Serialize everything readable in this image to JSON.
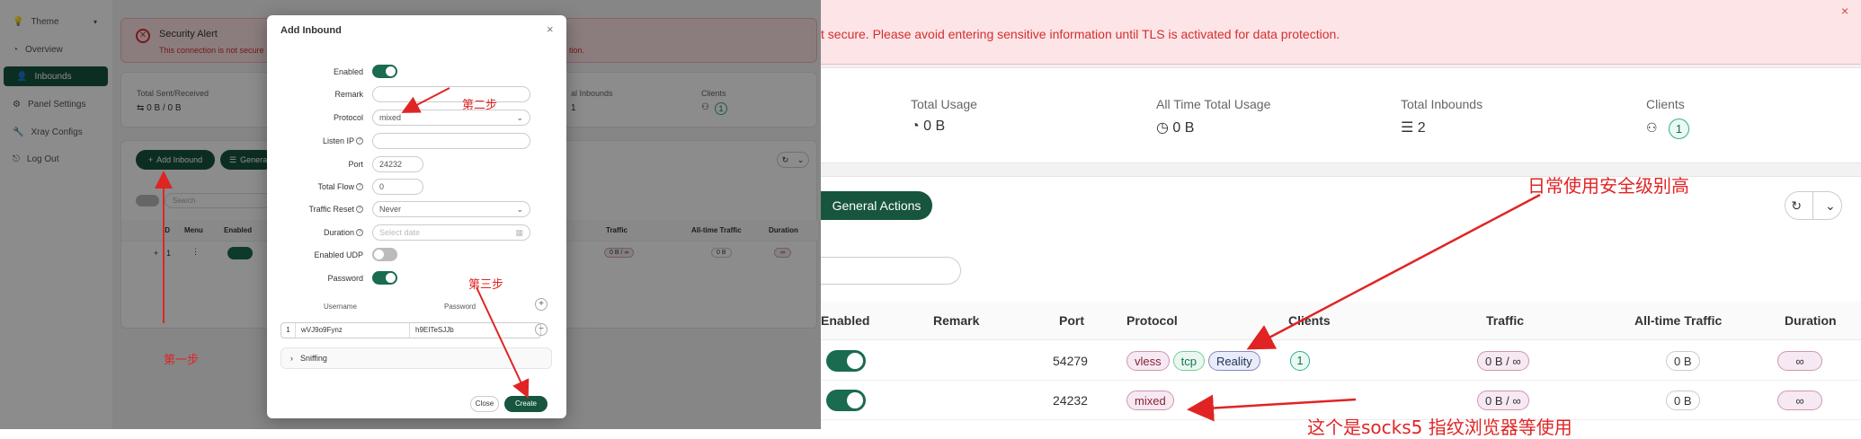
{
  "sidebar": {
    "items": [
      {
        "label": "Theme",
        "icon": "bulb-icon"
      },
      {
        "label": "Overview",
        "icon": "dashboard-icon"
      },
      {
        "label": "Inbounds",
        "icon": "user-icon"
      },
      {
        "label": "Panel Settings",
        "icon": "gear-icon"
      },
      {
        "label": "Xray Configs",
        "icon": "tool-icon"
      },
      {
        "label": "Log Out",
        "icon": "logout-icon"
      }
    ]
  },
  "alert": {
    "title": "Security Alert",
    "left_text": "This connection is not secure",
    "left_text_tail": "tion.",
    "right_text": "t secure. Please avoid entering sensitive information until TLS is activated for data protection."
  },
  "stats_left": {
    "sent_label": "Total Sent/Received",
    "sent_value": "0 B / 0 B",
    "inbounds_label": "al Inbounds",
    "inbounds_value": "1",
    "clients_label": "Clients",
    "clients_value": "1"
  },
  "stats_right": {
    "total_usage_label": "Total Usage",
    "total_usage_value": "0 B",
    "all_time_label": "All Time Total Usage",
    "all_time_value": "0 B",
    "inbounds_label": "Total Inbounds",
    "inbounds_value": "2",
    "clients_label": "Clients",
    "clients_value": "1"
  },
  "actions": {
    "add_inbound": "Add Inbound",
    "general": "Genera",
    "general_actions": "General Actions"
  },
  "left_table": {
    "search_placeholder": "Search",
    "headers": [
      "ID",
      "Menu",
      "Enabled",
      "Traffic",
      "All-time Traffic",
      "Duration"
    ],
    "row": {
      "id": "1",
      "traffic": "0 B / ∞",
      "all_time": "0 B",
      "duration": "∞"
    }
  },
  "modal": {
    "title": "Add Inbound",
    "fields": {
      "enabled": "Enabled",
      "remark": "Remark",
      "protocol": "Protocol",
      "protocol_value": "mixed",
      "listen_ip": "Listen IP",
      "port": "Port",
      "port_value": "24232",
      "total_flow": "Total Flow",
      "total_flow_value": "0",
      "traffic_reset": "Traffic Reset",
      "traffic_reset_value": "Never",
      "duration": "Duration",
      "duration_placeholder": "Select date",
      "enabled_udp": "Enabled UDP",
      "password": "Password"
    },
    "accounts": {
      "username_header": "Username",
      "password_header": "Password",
      "row_index": "1",
      "username": "wVJ9o9Fynz",
      "password": "h9EITeSJJb"
    },
    "sniffing": "Sniffing",
    "close": "Close",
    "create": "Create"
  },
  "right_table": {
    "headers": [
      "Enabled",
      "Remark",
      "Port",
      "Protocol",
      "Clients",
      "Traffic",
      "All-time Traffic",
      "Duration"
    ],
    "rows": [
      {
        "port": "54279",
        "protocols": [
          "vless",
          "tcp",
          "Reality"
        ],
        "clients": "1",
        "traffic": "0 B / ∞",
        "all_time": "0 B",
        "duration": "∞"
      },
      {
        "port": "24232",
        "protocols": [
          "mixed"
        ],
        "clients": "",
        "traffic": "0 B / ∞",
        "all_time": "0 B",
        "duration": "∞"
      }
    ]
  },
  "annotations": {
    "step1": "第一步",
    "step2": "第二步",
    "step3": "第三步",
    "security_note": "日常使用安全级别高",
    "socks_note": "这个是socks5 指纹浏览器等使用"
  },
  "colors": {
    "accent": "#17553f",
    "annotation": "#e02424",
    "alert_bg": "#fde4e6"
  }
}
